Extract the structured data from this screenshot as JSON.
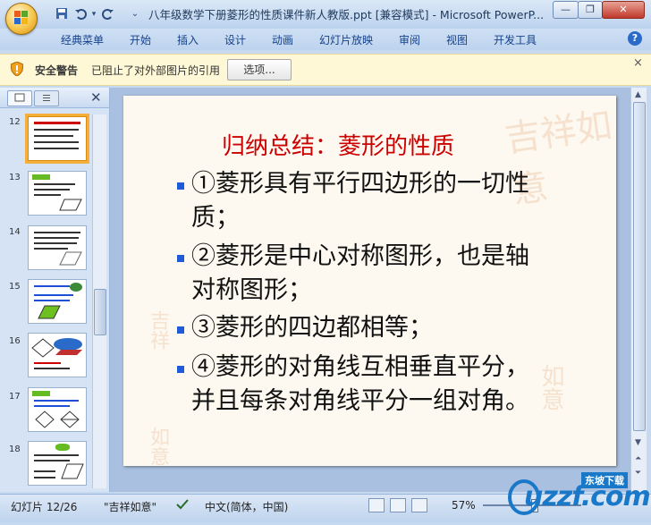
{
  "window": {
    "title": "八年级数学下册菱形的性质课件新人教版.ppt [兼容模式] - Microsoft PowerP...",
    "minimize": "—",
    "restore": "❐",
    "close": "✕"
  },
  "quick_access": {
    "save_icon": "save-icon",
    "undo_icon": "undo-icon",
    "redo_icon": "redo-icon",
    "customize_icon": "dropdown-icon"
  },
  "ribbon": {
    "tabs": [
      "经典菜单",
      "开始",
      "插入",
      "设计",
      "动画",
      "幻灯片放映",
      "审阅",
      "视图",
      "开发工具"
    ],
    "help": "?"
  },
  "security_bar": {
    "label": "安全警告",
    "message": "已阻止了对外部图片的引用",
    "button": "选项...",
    "close": "×"
  },
  "thumbnails": {
    "close": "✕",
    "items": [
      {
        "number": "12",
        "selected": true
      },
      {
        "number": "13",
        "selected": false
      },
      {
        "number": "14",
        "selected": false
      },
      {
        "number": "15",
        "selected": false
      },
      {
        "number": "16",
        "selected": false
      },
      {
        "number": "17",
        "selected": false
      },
      {
        "number": "18",
        "selected": false
      }
    ]
  },
  "slide": {
    "title": "归纳总结：菱形的性质",
    "bullets": [
      {
        "line1": "①菱形具有平行四边形的一切性",
        "line2": "质；"
      },
      {
        "line1": "②菱形是中心对称图形，也是轴",
        "line2": "对称图形；"
      },
      {
        "line1": "③菱形的四边都相等；",
        "line2": ""
      },
      {
        "line1": "④菱形的对角线互相垂直平分，",
        "line2": "并且每条对角线平分一组对角。"
      }
    ],
    "decor_text": "吉祥如意",
    "colors": {
      "title": "#cc0000",
      "bullet": "#1f5ad8",
      "background": "#fdf9f0"
    }
  },
  "status": {
    "slide_info": "幻灯片 12/26",
    "theme": "\"吉祥如意\"",
    "language": "中文(简体，中国)",
    "zoom": "57%"
  },
  "watermark": {
    "badge": "东坡下载",
    "text": "uzzf.com"
  }
}
